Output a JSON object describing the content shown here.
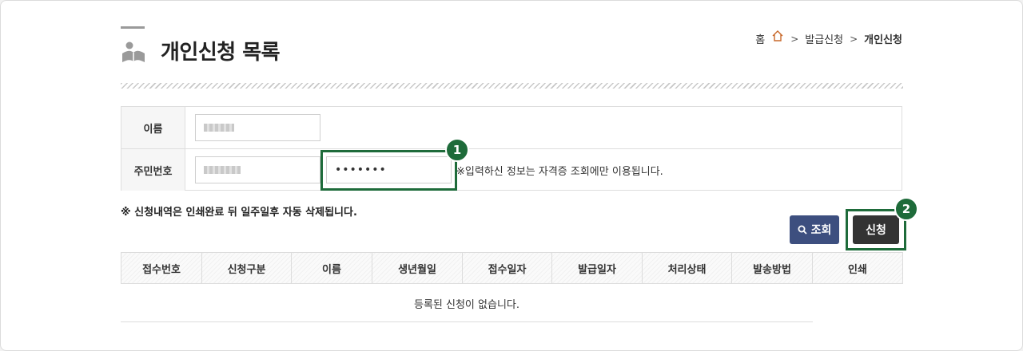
{
  "header": {
    "title": "개인신청 목록",
    "breadcrumb": {
      "home": "홈",
      "parent": "발급신청",
      "current": "개인신청"
    }
  },
  "form": {
    "name_label": "이름",
    "rrn_label": "주민번호",
    "rrn_back_value": "•••••••",
    "rrn_notice": "※입력하신 정보는 자격증 조회에만 이용됩니다."
  },
  "notice_delete": "※ 신청내역은 인쇄완료 뒤 일주일후 자동 삭제됩니다.",
  "buttons": {
    "search_label": "조회",
    "apply_label": "신청"
  },
  "annotations": {
    "step1": "1",
    "step2": "2"
  },
  "table": {
    "columns": [
      "접수번호",
      "신청구분",
      "이름",
      "생년월일",
      "접수일자",
      "발급일자",
      "처리상태",
      "발송방법",
      "인쇄"
    ],
    "empty_message": "등록된 신청이 없습니다."
  },
  "colors": {
    "highlight": "#1e6b3a",
    "search_button": "#3d4f7f",
    "apply_button": "#333333"
  }
}
